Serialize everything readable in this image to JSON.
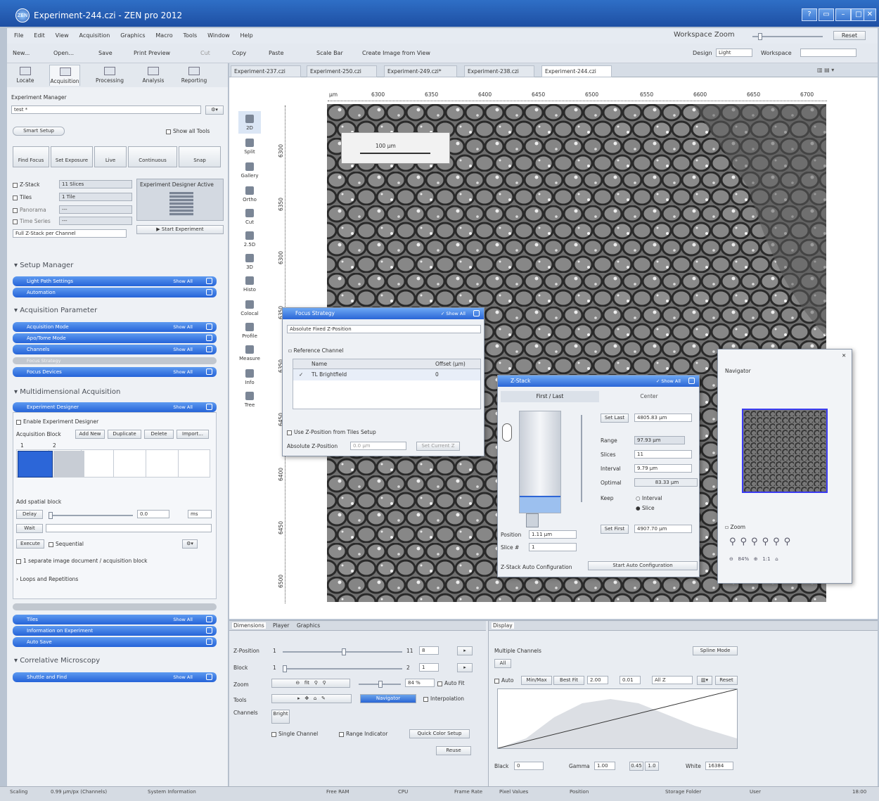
{
  "window": {
    "title": "Experiment-244.czi - ZEN pro 2012",
    "logo": "ZEN"
  },
  "menu": {
    "items": [
      "File",
      "Edit",
      "View",
      "Acquisition",
      "Graphics",
      "Macro",
      "Tools",
      "Window",
      "Help"
    ],
    "workspace_zoom_label": "Workspace Zoom",
    "reset": "Reset"
  },
  "toolbar": {
    "new": "New...",
    "open": "Open...",
    "save": "Save",
    "print_preview": "Print Preview",
    "cut": "Cut",
    "copy": "Copy",
    "paste": "Paste",
    "scale_bar": "Scale Bar",
    "create_image": "Create Image from View",
    "design_label": "Design",
    "design_value": "Light",
    "workspace_label": "Workspace"
  },
  "main_tabs": [
    {
      "label": "Locate"
    },
    {
      "label": "Acquisition"
    },
    {
      "label": "Processing"
    },
    {
      "label": "Analysis"
    },
    {
      "label": "Reporting"
    }
  ],
  "left": {
    "experiment_manager": "Experiment Manager",
    "experiment_name": "test *",
    "smart_setup": "Smart Setup",
    "show_all_tools": "Show all Tools",
    "actions": [
      "Find Focus",
      "Set Exposure",
      "Live",
      "Continuous",
      "Snap"
    ],
    "dims": [
      {
        "label": "Z-Stack",
        "value": "11 Slices"
      },
      {
        "label": "Tiles",
        "value": "1 Tile"
      },
      {
        "label": "Panorama",
        "value": "---"
      },
      {
        "label": "Time Series",
        "value": "---"
      }
    ],
    "designer_active": "Experiment Designer Active",
    "zstack_mode": "Full Z-Stack per Channel",
    "start_experiment": "Start Experiment",
    "setup_manager": "Setup Manager",
    "setup_items": [
      "Light Path Settings",
      "Automation"
    ],
    "acq_param": "Acquisition Parameter",
    "acq_items": [
      "Acquisition Mode",
      "Apo/Tome Mode",
      "Channels",
      "Focus Strategy",
      "Focus Devices"
    ],
    "multidim": "Multidimensional Acquisition",
    "designer": "Experiment Designer",
    "enable_designer": "Enable Experiment Designer",
    "acq_block": "Acquisition Block",
    "block_buttons": [
      "Add New",
      "Duplicate",
      "Delete",
      "Import..."
    ],
    "block_numbers": [
      "1",
      "2"
    ],
    "add_spatial": "Add spatial block",
    "delay": "Delay",
    "delay_value": "0.0",
    "delay_unit": "ms",
    "wait": "Wait",
    "execute": "Execute",
    "sequential": "Sequential",
    "separate_doc": "1 separate image document / acquisition block",
    "loops": "Loops and Repetitions",
    "more_items": [
      "Tiles",
      "Information on Experiment",
      "Auto Save"
    ],
    "correlative": "Correlative Microscopy",
    "shuttle": "Shuttle and Find",
    "show_all": "Show All"
  },
  "doc_tabs": [
    "Experiment-237.czi",
    "Experiment-250.czi",
    "Experiment-249.czi*",
    "Experiment-238.czi",
    "Experiment-244.czi"
  ],
  "view_tools": [
    "2D",
    "Split",
    "Gallery",
    "Ortho",
    "Cut",
    "2.5D",
    "3D",
    "Histo",
    "Colocal",
    "Profile",
    "Measure",
    "Info",
    "Tree"
  ],
  "ruler": {
    "x_ticks": [
      "µm",
      "6300",
      "6350",
      "6400",
      "6450",
      "6500",
      "6550",
      "6600",
      "6650",
      "6700"
    ],
    "y_ticks": [
      "6300",
      "6350",
      "6300",
      "6350",
      "6350",
      "6450",
      "6400",
      "6450",
      "6500"
    ]
  },
  "scalebar": "100 µm",
  "focus_strategy": {
    "title": "Focus Strategy",
    "mode": "Absolute Fixed Z-Position",
    "ref_channel": "Reference Channel",
    "col_name": "Name",
    "col_offset": "Offset (µm)",
    "channel": "TL Brightfield",
    "offset": "0",
    "use_tiles": "Use Z-Position from Tiles Setup",
    "abs_z": "Absolute Z-Position",
    "abs_z_value": "0.0 µm",
    "set_current": "Set Current Z"
  },
  "zstack": {
    "title": "Z-Stack",
    "tab_first": "First / Last",
    "tab_center": "Center",
    "set_last": "Set Last",
    "last_val": "4805.83 µm",
    "range_l": "Range",
    "range": "97.93 µm",
    "slices_l": "Slices",
    "slices": "11",
    "interval_l": "Interval",
    "interval": "9.79 µm",
    "optimal_l": "Optimal",
    "optimal": "83.33 µm",
    "keep_l": "Keep",
    "keep_opts": [
      "Interval",
      "Slice"
    ],
    "set_first": "Set First",
    "first_val": "4907.70 µm",
    "position_l": "Position",
    "position": "1.11 µm",
    "slice_l": "Slice #",
    "slice": "1",
    "auto_cfg": "Z-Stack Auto Configuration",
    "start_auto": "Start Auto Configuration"
  },
  "navigator": {
    "title": "Navigator",
    "zoom": "Zoom"
  },
  "bottom": {
    "tabs": [
      "Dimensions",
      "Player",
      "Graphics"
    ],
    "zpos": "Z-Position",
    "zpos_min": "1",
    "zpos_max": "11",
    "zpos_val": "8",
    "block": "Block",
    "block_min": "1",
    "block_max": "2",
    "block_val": "1",
    "zoom": "Zoom",
    "zoom_val": "84 %",
    "autofit": "Auto Fit",
    "tools": "Tools",
    "navigator": "Navigator",
    "interp": "Interpolation",
    "channels": "Channels",
    "ch_btn": "Bright",
    "single": "Single Channel",
    "range": "Range Indicator",
    "quick": "Quick Color Setup",
    "reuse": "Reuse",
    "display": "Display",
    "multi": "Multiple Channels",
    "all": "All",
    "spline": "Spline Mode",
    "auto": "Auto",
    "minmax": "Min/Max",
    "bestfit": "Best Fit",
    "v1": "2.00",
    "v2": "0.01",
    "allz": "All Z",
    "reset": "Reset",
    "black": "Black",
    "black_val": "0",
    "gamma": "Gamma",
    "gamma_val": "1.00",
    "g1": "0.45",
    "g2": "1.0",
    "white": "White",
    "white_val": "16384"
  },
  "status": [
    "Scaling",
    "0.99 µm/px (Channels)",
    "System Information",
    "Free RAM",
    "CPU",
    "Frame Rate",
    "Pixel Values",
    "Position",
    "Storage Folder",
    "User",
    "18:00"
  ]
}
